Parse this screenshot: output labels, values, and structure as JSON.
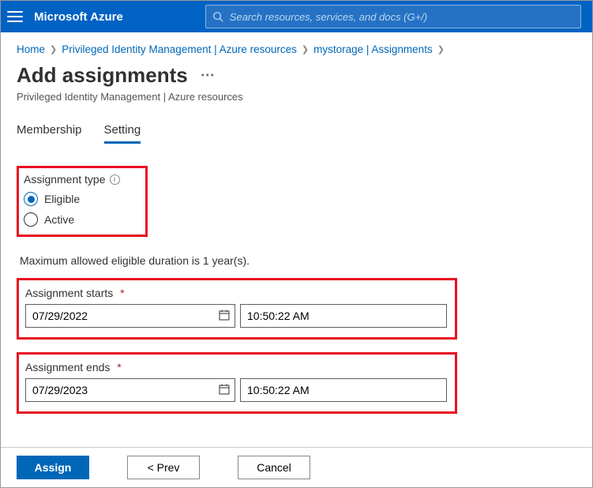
{
  "brand": "Microsoft Azure",
  "search_placeholder": "Search resources, services, and docs (G+/)",
  "breadcrumbs": {
    "home": "Home",
    "pim": "Privileged Identity Management | Azure resources",
    "resource": "mystorage | Assignments"
  },
  "page": {
    "title": "Add assignments",
    "subtitle": "Privileged Identity Management | Azure resources"
  },
  "tabs": {
    "membership": "Membership",
    "setting": "Setting"
  },
  "assignment_type": {
    "label": "Assignment type",
    "options": {
      "eligible": "Eligible",
      "active": "Active"
    },
    "selected": "eligible"
  },
  "duration_note": "Maximum allowed eligible duration is 1 year(s).",
  "starts": {
    "label": "Assignment starts",
    "date": "07/29/2022",
    "time": "10:50:22 AM"
  },
  "ends": {
    "label": "Assignment ends",
    "date": "07/29/2023",
    "time": "10:50:22 AM"
  },
  "buttons": {
    "assign": "Assign",
    "prev": "<  Prev",
    "cancel": "Cancel"
  }
}
